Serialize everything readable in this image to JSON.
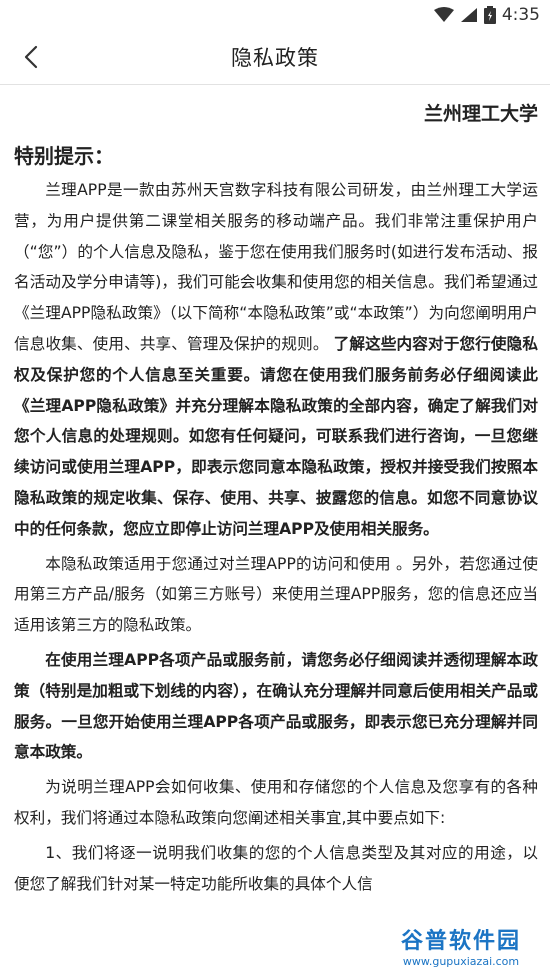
{
  "status_bar": {
    "time": "4:35"
  },
  "header": {
    "title": "隐私政策"
  },
  "content": {
    "org_name": "兰州理工大学",
    "notice_title": "特别提示：",
    "p1_normal": "兰理APP是一款由苏州天宫数字科技有限公司研发，由兰州理工大学运营，为用户提供第二课堂相关服务的移动端产品。我们非常注重保护用户（“您”）的个人信息及隐私，鉴于您在使用我们服务时(如进行发布活动、报名活动及学分申请等)，我们可能会收集和使用您的相关信息。我们希望通过《兰理APP隐私政策》（以下简称“本隐私政策”或“本政策”）为向您阐明用户信息收集、使用、共享、管理及保护的规则。",
    "p1_bold": "了解这些内容对于您行使隐私权及保护您的个人信息至关重要。请您在使用我们服务前务必仔细阅读此《兰理APP隐私政策》并充分理解本隐私政策的全部内容，确定了解我们对您个人信息的处理规则。如您有任何疑问，可联系我们进行咨询，一旦您继续访问或使用兰理APP，即表示您同意本隐私政策，授权并接受我们按照本隐私政策的规定收集、保存、使用、共享、披露您的信息。如您不同意协议中的任何条款，您应立即停止访问兰理APP及使用相关服务。",
    "p2": "本隐私政策适用于您通过对兰理APP的访问和使用 。另外，若您通过使用第三方产品/服务（如第三方账号）来使用兰理APP服务，您的信息还应当适用该第三方的隐私政策。",
    "p3": "在使用兰理APP各项产品或服务前，请您务必仔细阅读并透彻理解本政策（特别是加粗或下划线的内容），在确认充分理解并同意后使用相关产品或服务。一旦您开始使用兰理APP各项产品或服务，即表示您已充分理解并同意本政策。",
    "p4": "为说明兰理APP会如何收集、使用和存储您的个人信息及您享有的各种权利，我们将通过本隐私政策向您阐述相关事宜,其中要点如下:",
    "p5": "1、我们将逐一说明我们收集的您的个人信息类型及其对应的用途，以便您了解我们针对某一特定功能所收集的具体个人信"
  },
  "watermark": {
    "name": "谷普软件园",
    "url": "www.gupuxiazai.com"
  },
  "colors": {
    "watermark_blue": "#1b74c4"
  }
}
